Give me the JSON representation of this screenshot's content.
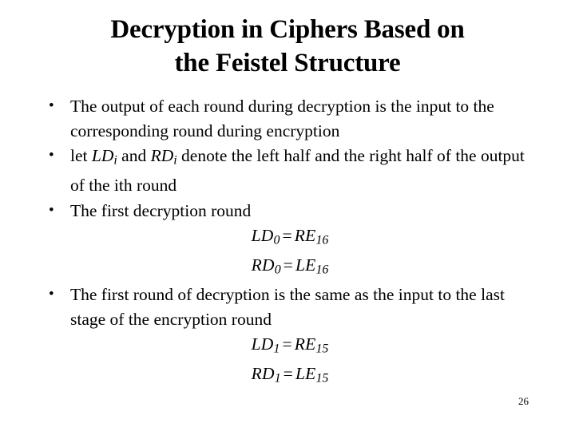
{
  "slide": {
    "page_number": "26",
    "background_color": "#ffffff",
    "text_color": "#000000",
    "title": {
      "full": "Decryption in Ciphers Based on the Feistel Structure",
      "line1": "Decryption in Ciphers Based on",
      "line2": "the Feistel Structure"
    },
    "bullet_glyph": "•",
    "body": {
      "items": [
        {
          "type": "bullet",
          "text": "The output of each round during decryption is the input to the corresponding round during encryption"
        },
        {
          "type": "bullet-rich",
          "text": "let LDi and RDi denote the left half and the right half of the output of the ith round",
          "parts": {
            "p1": "let ",
            "var1_base": "LD",
            "var1_sub": "i",
            "p2": " and ",
            "var2_base": "RD",
            "var2_sub": "i",
            "p3": " denote the left half and the right half of the output of the ith round"
          }
        },
        {
          "type": "bullet",
          "text": "The first decryption round"
        },
        {
          "type": "equation",
          "text": "LD0 = RE16",
          "left_base": "LD",
          "left_sub": "0",
          "operator": "=",
          "right_base": "RE",
          "right_sub": "16"
        },
        {
          "type": "equation",
          "text": "RD0 = LE16",
          "left_base": "RD",
          "left_sub": "0",
          "operator": "=",
          "right_base": "LE",
          "right_sub": "16"
        },
        {
          "type": "bullet",
          "text": "The first round of decryption is the same as the input to the last stage of the encryption round"
        },
        {
          "type": "equation",
          "text": "LD1 = RE15",
          "left_base": "LD",
          "left_sub": "1",
          "operator": "=",
          "right_base": "RE",
          "right_sub": "15"
        },
        {
          "type": "equation",
          "text": "RD1 = LE15",
          "left_base": "RD",
          "left_sub": "1",
          "operator": "=",
          "right_base": "LE",
          "right_sub": "15"
        }
      ]
    }
  }
}
